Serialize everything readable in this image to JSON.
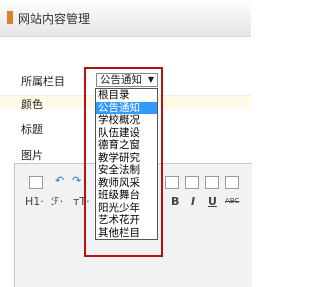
{
  "header": {
    "title": "网站内容管理"
  },
  "form": {
    "category_label": "所属栏目",
    "color_label": "颜色",
    "title_label": "标题",
    "image_label": "图片"
  },
  "select": {
    "value": "公告通知",
    "options": [
      "根目录",
      "公告通知",
      "学校概况",
      "队伍建设",
      "德育之窗",
      "教学研究",
      "安全法制",
      "教师风采",
      "班级舞台",
      "阳光少年",
      "艺术花开",
      "其他栏目"
    ],
    "highlighted_index": 1
  },
  "toolbar": {
    "row2": [
      "H1·",
      "ℱ·",
      "тT·",
      "B",
      "I",
      "U",
      "ABC"
    ]
  },
  "colors": {
    "highlight_border": "#b01414",
    "selected_option": "#3399ff",
    "accent": "#d9822b"
  }
}
